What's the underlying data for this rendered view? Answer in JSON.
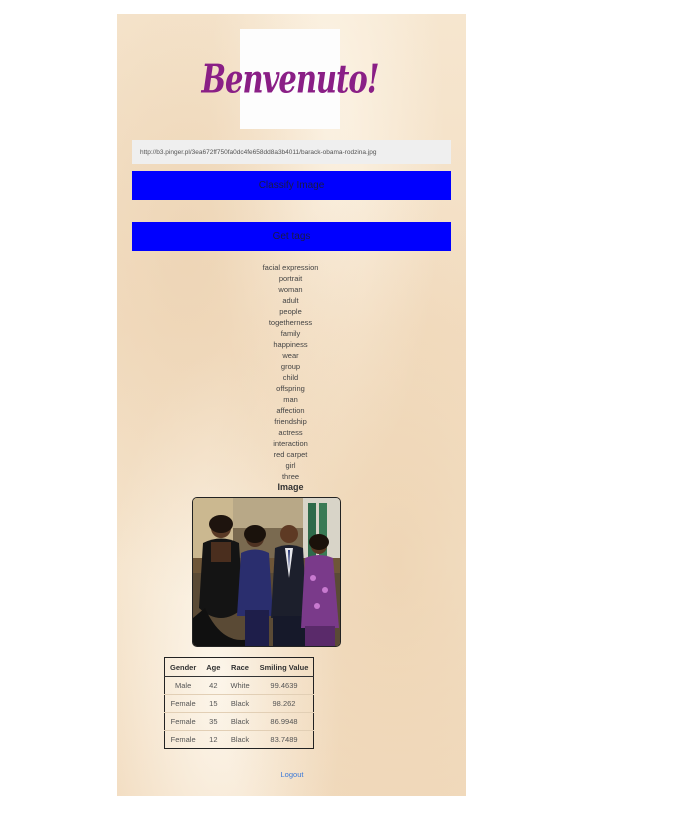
{
  "logo": {
    "text": "Benvenuto!"
  },
  "url_input": {
    "value": "http://b3.pinger.pl/3ea672ff750fa0dc4fe658dd8a3b4011/barack-obama-rodzina.jpg"
  },
  "buttons": {
    "classify": "Classify Image",
    "get_tags": "Get tags"
  },
  "tags": [
    "facial expression",
    "portrait",
    "woman",
    "adult",
    "people",
    "togetherness",
    "family",
    "happiness",
    "wear",
    "group",
    "child",
    "offspring",
    "man",
    "affection",
    "friendship",
    "actress",
    "interaction",
    "red carpet",
    "girl",
    "three"
  ],
  "image_heading": "Image",
  "table": {
    "headers": [
      "Gender",
      "Age",
      "Race",
      "Smiling Value"
    ],
    "rows": [
      [
        "Male",
        "42",
        "White",
        "99.4639"
      ],
      [
        "Female",
        "15",
        "Black",
        "98.262"
      ],
      [
        "Female",
        "35",
        "Black",
        "86.9948"
      ],
      [
        "Female",
        "12",
        "Black",
        "83.7489"
      ]
    ]
  },
  "logout": "Logout",
  "colors": {
    "button": "#0000ff",
    "logo_text": "#8a1f86",
    "link": "#3a78d8",
    "panel": "#f5e4cc"
  }
}
